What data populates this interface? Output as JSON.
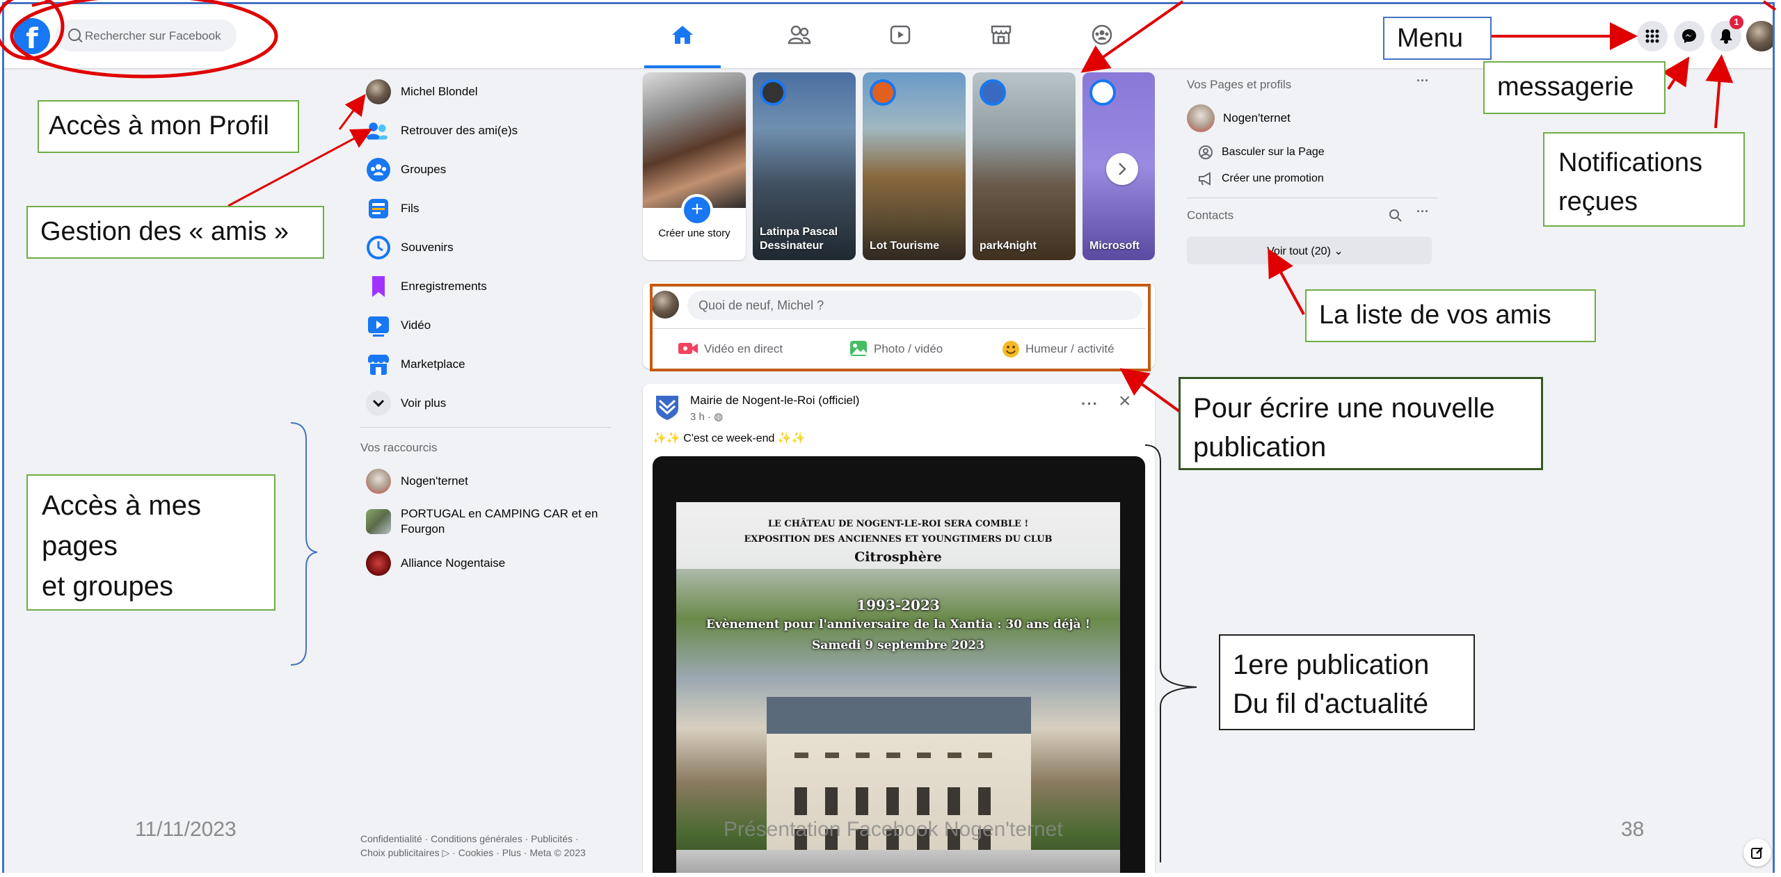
{
  "facebook": {
    "search_placeholder": "Rechercher sur Facebook",
    "logo_letter": "f",
    "notification_count": "1",
    "left_menu": [
      {
        "label": "Michel Blondel"
      },
      {
        "label": "Retrouver des ami(e)s"
      },
      {
        "label": "Groupes"
      },
      {
        "label": "Fils"
      },
      {
        "label": "Souvenirs"
      },
      {
        "label": "Enregistrements"
      },
      {
        "label": "Vidéo"
      },
      {
        "label": "Marketplace"
      },
      {
        "label": "Voir plus"
      }
    ],
    "shortcuts_title": "Vos raccourcis",
    "shortcuts": [
      {
        "label": "Nogen'ternet"
      },
      {
        "label": "PORTUGAL en CAMPING CAR et en Fourgon"
      },
      {
        "label": "Alliance Nogentaise"
      }
    ],
    "footer": "Confidentialité · Conditions générales · Publicités · Choix publicitaires ▷ · Cookies · Plus · Meta © 2023",
    "stories": [
      {
        "label": "Créer une story"
      },
      {
        "label": "Latinpa Pascal Dessinateur"
      },
      {
        "label": "Lot Tourisme"
      },
      {
        "label": "park4night"
      },
      {
        "label": "Microsoft"
      }
    ],
    "composer": {
      "placeholder": "Quoi de neuf, Michel ?",
      "actions": [
        "Vidéo en direct",
        "Photo / vidéo",
        "Humeur / activité"
      ]
    },
    "post": {
      "author": "Mairie de Nogent-le-Roi (officiel)",
      "time": "3 h · ",
      "text": "✨✨ C'est ce week-end ✨✨",
      "poster_line1": "LE CHÂTEAU DE NOGENT-LE-ROI SERA COMBLE !",
      "poster_line2": "EXPOSITION DES ANCIENNES ET YOUNGTIMERS DU CLUB",
      "poster_line3": "Citrosphère",
      "poster_line4": "1993-2023",
      "poster_line5": "Evènement pour l'anniversaire de la Xantia : 30 ans déjà !",
      "poster_line6": "Samedi 9 septembre 2023"
    },
    "right_panel": {
      "pages_title": "Vos Pages et profils",
      "page_name": "Nogen'ternet",
      "switch_label": "Basculer sur la Page",
      "promo_label": "Créer une promotion",
      "contacts_title": "Contacts",
      "see_all": "Voir tout (20)"
    }
  },
  "annotations": {
    "menu": "Menu",
    "messagerie": "messagerie",
    "notifications_line1": "Notifications",
    "notifications_line2": "reçues",
    "profil": "Accès à mon Profil",
    "amis": "Gestion des « amis »",
    "pages_line1": "Accès à mes",
    "pages_line2": "pages",
    "pages_line3": "et groupes",
    "liste_amis": "La liste de vos amis",
    "ecrire_line1": "Pour écrire une nouvelle",
    "ecrire_line2": "publication",
    "premiere_line1": "1ere publication",
    "premiere_line2": "Du fil d'actualité"
  },
  "slide_footer": {
    "date": "11/11/2023",
    "title": "Présentation Facebook Nogen'ternet",
    "page": "38"
  },
  "colors": {
    "fb_blue": "#1877f2",
    "annotation_red": "#e00000",
    "frame_blue": "#4472c4",
    "box_green": "#70ad47"
  }
}
